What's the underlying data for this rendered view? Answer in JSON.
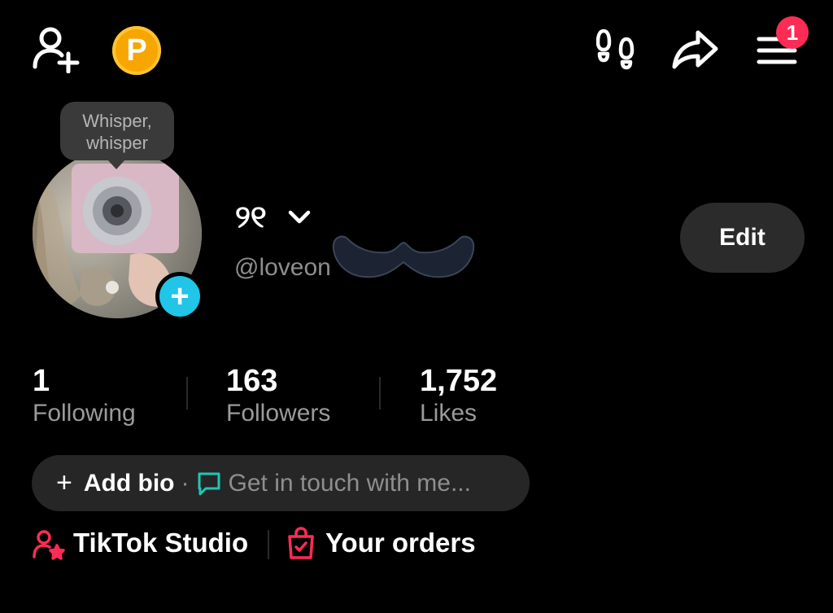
{
  "header": {
    "coin_letter": "P",
    "notification_count": "1"
  },
  "profile": {
    "whisper_line1": "Whisper,",
    "whisper_line2": "whisper",
    "nickname": "୨୧",
    "handle": "@loveon",
    "edit_label": "Edit"
  },
  "stats": [
    {
      "value": "1",
      "label": "Following"
    },
    {
      "value": "163",
      "label": "Followers"
    },
    {
      "value": "1,752",
      "label": "Likes"
    }
  ],
  "bio": {
    "plus": "+",
    "add_label": "Add bio",
    "dot": "·",
    "touch_label": "Get in touch with me..."
  },
  "links": [
    {
      "label": "TikTok Studio"
    },
    {
      "label": "Your orders"
    }
  ],
  "colors": {
    "accent": "#fe2c55",
    "avatar_add": "#20c5e8",
    "coin": "#f7a600",
    "chat_icon": "#1ec7b5"
  },
  "icons": [
    "add-friend-icon",
    "coin-icon",
    "footprints-icon",
    "share-icon",
    "menu-icon",
    "chevron-down-icon",
    "plus-icon",
    "chat-bubble-icon",
    "creator-star-icon",
    "shopping-bag-icon"
  ]
}
